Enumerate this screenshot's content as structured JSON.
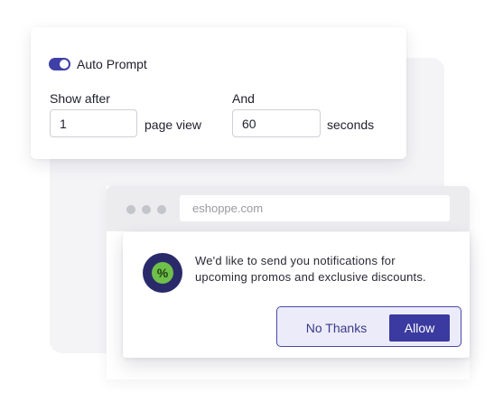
{
  "settings": {
    "auto_prompt": {
      "label": "Auto Prompt",
      "enabled": true
    },
    "show_after": {
      "label": "Show after",
      "value": "1",
      "unit": "page view"
    },
    "and": {
      "label": "And",
      "value": "60",
      "unit": "seconds"
    }
  },
  "browser": {
    "address": "eshoppe.com"
  },
  "prompt": {
    "icon": "percent-badge-icon",
    "icon_glyph": "%",
    "message_line1": "We'd like to send you notifications for",
    "message_line2": "upcoming promos and exclusive discounts.",
    "no_thanks_label": "No Thanks",
    "allow_label": "Allow"
  },
  "colors": {
    "accent": "#3a3aa0",
    "toggle_on": "#3f3fa8",
    "button_group_bg": "#ecebfa",
    "promo_badge": "#2a2a6a",
    "promo_inner": "#6fc04a"
  }
}
